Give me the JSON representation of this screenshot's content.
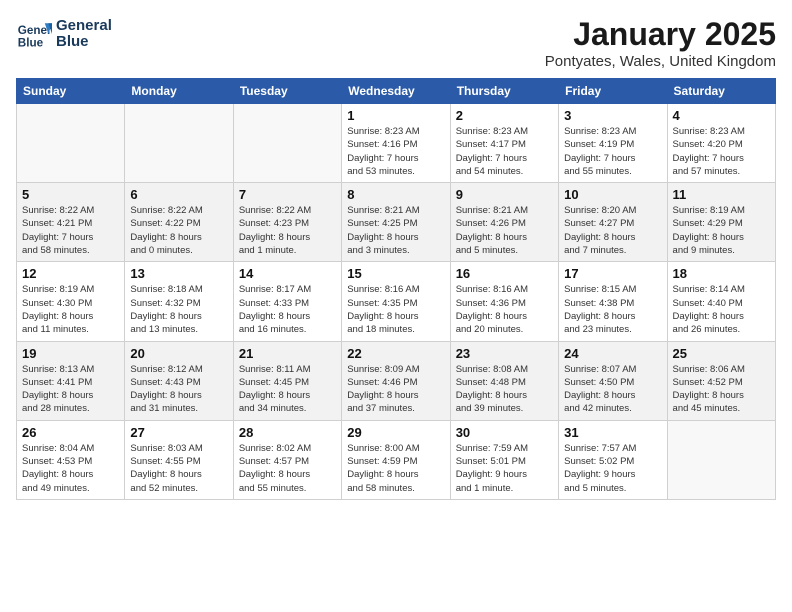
{
  "logo": {
    "line1": "General",
    "line2": "Blue"
  },
  "title": "January 2025",
  "location": "Pontyates, Wales, United Kingdom",
  "days_of_week": [
    "Sunday",
    "Monday",
    "Tuesday",
    "Wednesday",
    "Thursday",
    "Friday",
    "Saturday"
  ],
  "weeks": [
    [
      {
        "day": "",
        "info": ""
      },
      {
        "day": "",
        "info": ""
      },
      {
        "day": "",
        "info": ""
      },
      {
        "day": "1",
        "info": "Sunrise: 8:23 AM\nSunset: 4:16 PM\nDaylight: 7 hours\nand 53 minutes."
      },
      {
        "day": "2",
        "info": "Sunrise: 8:23 AM\nSunset: 4:17 PM\nDaylight: 7 hours\nand 54 minutes."
      },
      {
        "day": "3",
        "info": "Sunrise: 8:23 AM\nSunset: 4:19 PM\nDaylight: 7 hours\nand 55 minutes."
      },
      {
        "day": "4",
        "info": "Sunrise: 8:23 AM\nSunset: 4:20 PM\nDaylight: 7 hours\nand 57 minutes."
      }
    ],
    [
      {
        "day": "5",
        "info": "Sunrise: 8:22 AM\nSunset: 4:21 PM\nDaylight: 7 hours\nand 58 minutes."
      },
      {
        "day": "6",
        "info": "Sunrise: 8:22 AM\nSunset: 4:22 PM\nDaylight: 8 hours\nand 0 minutes."
      },
      {
        "day": "7",
        "info": "Sunrise: 8:22 AM\nSunset: 4:23 PM\nDaylight: 8 hours\nand 1 minute."
      },
      {
        "day": "8",
        "info": "Sunrise: 8:21 AM\nSunset: 4:25 PM\nDaylight: 8 hours\nand 3 minutes."
      },
      {
        "day": "9",
        "info": "Sunrise: 8:21 AM\nSunset: 4:26 PM\nDaylight: 8 hours\nand 5 minutes."
      },
      {
        "day": "10",
        "info": "Sunrise: 8:20 AM\nSunset: 4:27 PM\nDaylight: 8 hours\nand 7 minutes."
      },
      {
        "day": "11",
        "info": "Sunrise: 8:19 AM\nSunset: 4:29 PM\nDaylight: 8 hours\nand 9 minutes."
      }
    ],
    [
      {
        "day": "12",
        "info": "Sunrise: 8:19 AM\nSunset: 4:30 PM\nDaylight: 8 hours\nand 11 minutes."
      },
      {
        "day": "13",
        "info": "Sunrise: 8:18 AM\nSunset: 4:32 PM\nDaylight: 8 hours\nand 13 minutes."
      },
      {
        "day": "14",
        "info": "Sunrise: 8:17 AM\nSunset: 4:33 PM\nDaylight: 8 hours\nand 16 minutes."
      },
      {
        "day": "15",
        "info": "Sunrise: 8:16 AM\nSunset: 4:35 PM\nDaylight: 8 hours\nand 18 minutes."
      },
      {
        "day": "16",
        "info": "Sunrise: 8:16 AM\nSunset: 4:36 PM\nDaylight: 8 hours\nand 20 minutes."
      },
      {
        "day": "17",
        "info": "Sunrise: 8:15 AM\nSunset: 4:38 PM\nDaylight: 8 hours\nand 23 minutes."
      },
      {
        "day": "18",
        "info": "Sunrise: 8:14 AM\nSunset: 4:40 PM\nDaylight: 8 hours\nand 26 minutes."
      }
    ],
    [
      {
        "day": "19",
        "info": "Sunrise: 8:13 AM\nSunset: 4:41 PM\nDaylight: 8 hours\nand 28 minutes."
      },
      {
        "day": "20",
        "info": "Sunrise: 8:12 AM\nSunset: 4:43 PM\nDaylight: 8 hours\nand 31 minutes."
      },
      {
        "day": "21",
        "info": "Sunrise: 8:11 AM\nSunset: 4:45 PM\nDaylight: 8 hours\nand 34 minutes."
      },
      {
        "day": "22",
        "info": "Sunrise: 8:09 AM\nSunset: 4:46 PM\nDaylight: 8 hours\nand 37 minutes."
      },
      {
        "day": "23",
        "info": "Sunrise: 8:08 AM\nSunset: 4:48 PM\nDaylight: 8 hours\nand 39 minutes."
      },
      {
        "day": "24",
        "info": "Sunrise: 8:07 AM\nSunset: 4:50 PM\nDaylight: 8 hours\nand 42 minutes."
      },
      {
        "day": "25",
        "info": "Sunrise: 8:06 AM\nSunset: 4:52 PM\nDaylight: 8 hours\nand 45 minutes."
      }
    ],
    [
      {
        "day": "26",
        "info": "Sunrise: 8:04 AM\nSunset: 4:53 PM\nDaylight: 8 hours\nand 49 minutes."
      },
      {
        "day": "27",
        "info": "Sunrise: 8:03 AM\nSunset: 4:55 PM\nDaylight: 8 hours\nand 52 minutes."
      },
      {
        "day": "28",
        "info": "Sunrise: 8:02 AM\nSunset: 4:57 PM\nDaylight: 8 hours\nand 55 minutes."
      },
      {
        "day": "29",
        "info": "Sunrise: 8:00 AM\nSunset: 4:59 PM\nDaylight: 8 hours\nand 58 minutes."
      },
      {
        "day": "30",
        "info": "Sunrise: 7:59 AM\nSunset: 5:01 PM\nDaylight: 9 hours\nand 1 minute."
      },
      {
        "day": "31",
        "info": "Sunrise: 7:57 AM\nSunset: 5:02 PM\nDaylight: 9 hours\nand 5 minutes."
      },
      {
        "day": "",
        "info": ""
      }
    ]
  ]
}
